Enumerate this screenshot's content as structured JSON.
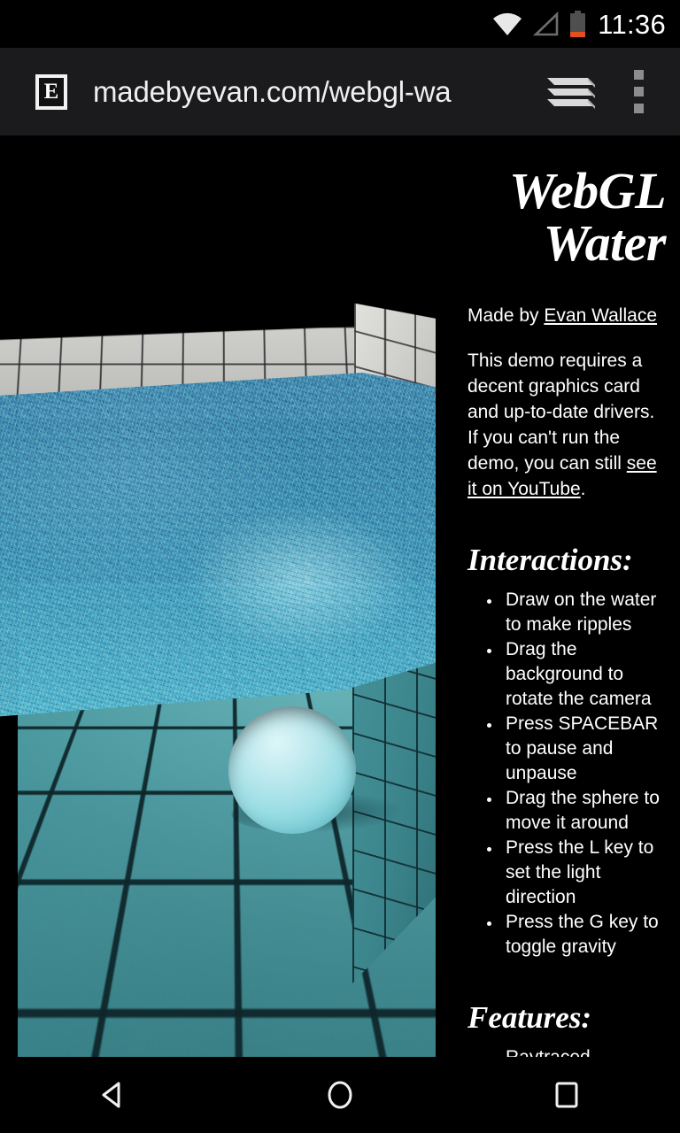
{
  "status_bar": {
    "clock": "11:36",
    "icons": [
      "wifi-icon",
      "cell-signal-icon",
      "battery-icon"
    ],
    "battery_level_color": "#e2501e"
  },
  "browser": {
    "favicon_letter": "E",
    "url": "madebyevan.com/webgl-wa",
    "tabs_label": "",
    "menu_label": "",
    "toolbar_bg": "#1b1b1d"
  },
  "page": {
    "title": "WebGL Water",
    "made_by_prefix": "Made by ",
    "author_link": "Evan Wallace",
    "intro_before": "This demo requires a decent graphics card and up-to-date drivers. If you can't run the demo, you can still ",
    "intro_link": "see it on YouTube",
    "intro_after": ".",
    "sections": [
      {
        "heading": "Interactions:",
        "items": [
          "Draw on the water to make ripples",
          "Drag the background to rotate the camera",
          "Press SPACEBAR to pause and unpause",
          "Drag the sphere to move it around",
          "Press the L key to set the light direction",
          "Press the G key to toggle gravity"
        ]
      },
      {
        "heading": "Features:",
        "items": [
          "Raytraced reflections and"
        ]
      }
    ],
    "canvas_alt": "WebGL water pool simulation with tiled pool, rippling water surface and a floating sphere"
  },
  "nav_bar": {
    "back_label": "Back",
    "home_label": "Home",
    "recents_label": "Recents"
  }
}
